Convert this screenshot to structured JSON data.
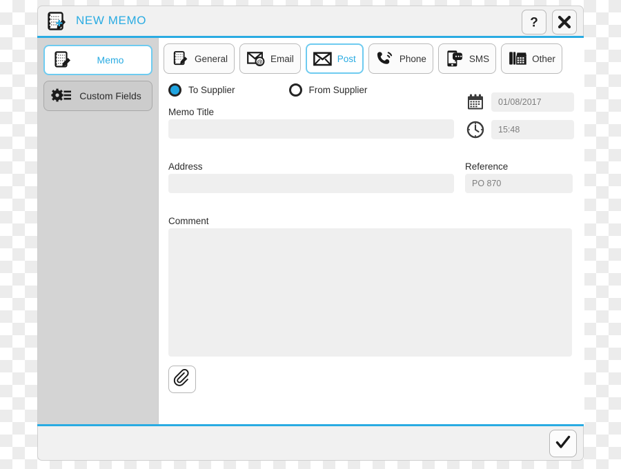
{
  "window": {
    "title": "NEW MEMO",
    "title_icon": "new-memo-icon",
    "accent_color": "#29abe2",
    "help_label": "?",
    "close_label": "✕"
  },
  "sidebar": {
    "items": [
      {
        "label": "Memo",
        "icon": "memo-pencil-icon",
        "selected": true
      },
      {
        "label": "Custom Fields",
        "icon": "gear-list-icon",
        "selected": false
      }
    ]
  },
  "tabs": [
    {
      "label": "General",
      "icon": "notepad-pencil-icon",
      "selected": false
    },
    {
      "label": "Email",
      "icon": "envelope-at-icon",
      "selected": false
    },
    {
      "label": "Post",
      "icon": "envelope-icon",
      "selected": true
    },
    {
      "label": "Phone",
      "icon": "phone-handset-icon",
      "selected": false
    },
    {
      "label": "SMS",
      "icon": "mobile-chat-icon",
      "selected": false
    },
    {
      "label": "Other",
      "icon": "desk-phone-icon",
      "selected": false
    }
  ],
  "direction": {
    "options": [
      {
        "label": "To Supplier",
        "selected": true
      },
      {
        "label": "From Supplier",
        "selected": false
      }
    ]
  },
  "form": {
    "memo_title": {
      "label": "Memo Title",
      "value": "",
      "placeholder": ""
    },
    "address": {
      "label": "Address",
      "value": "",
      "placeholder": ""
    },
    "comment": {
      "label": "Comment",
      "value": "",
      "placeholder": ""
    },
    "reference": {
      "label": "Reference",
      "value": "PO 870"
    },
    "date": {
      "icon": "calendar-icon",
      "value": "01/08/2017"
    },
    "time": {
      "icon": "clock-icon",
      "value": "15:48"
    }
  },
  "actions": {
    "attach": {
      "icon": "paperclip-icon",
      "label": ""
    },
    "confirm": {
      "icon": "checkmark-icon",
      "label": ""
    }
  }
}
